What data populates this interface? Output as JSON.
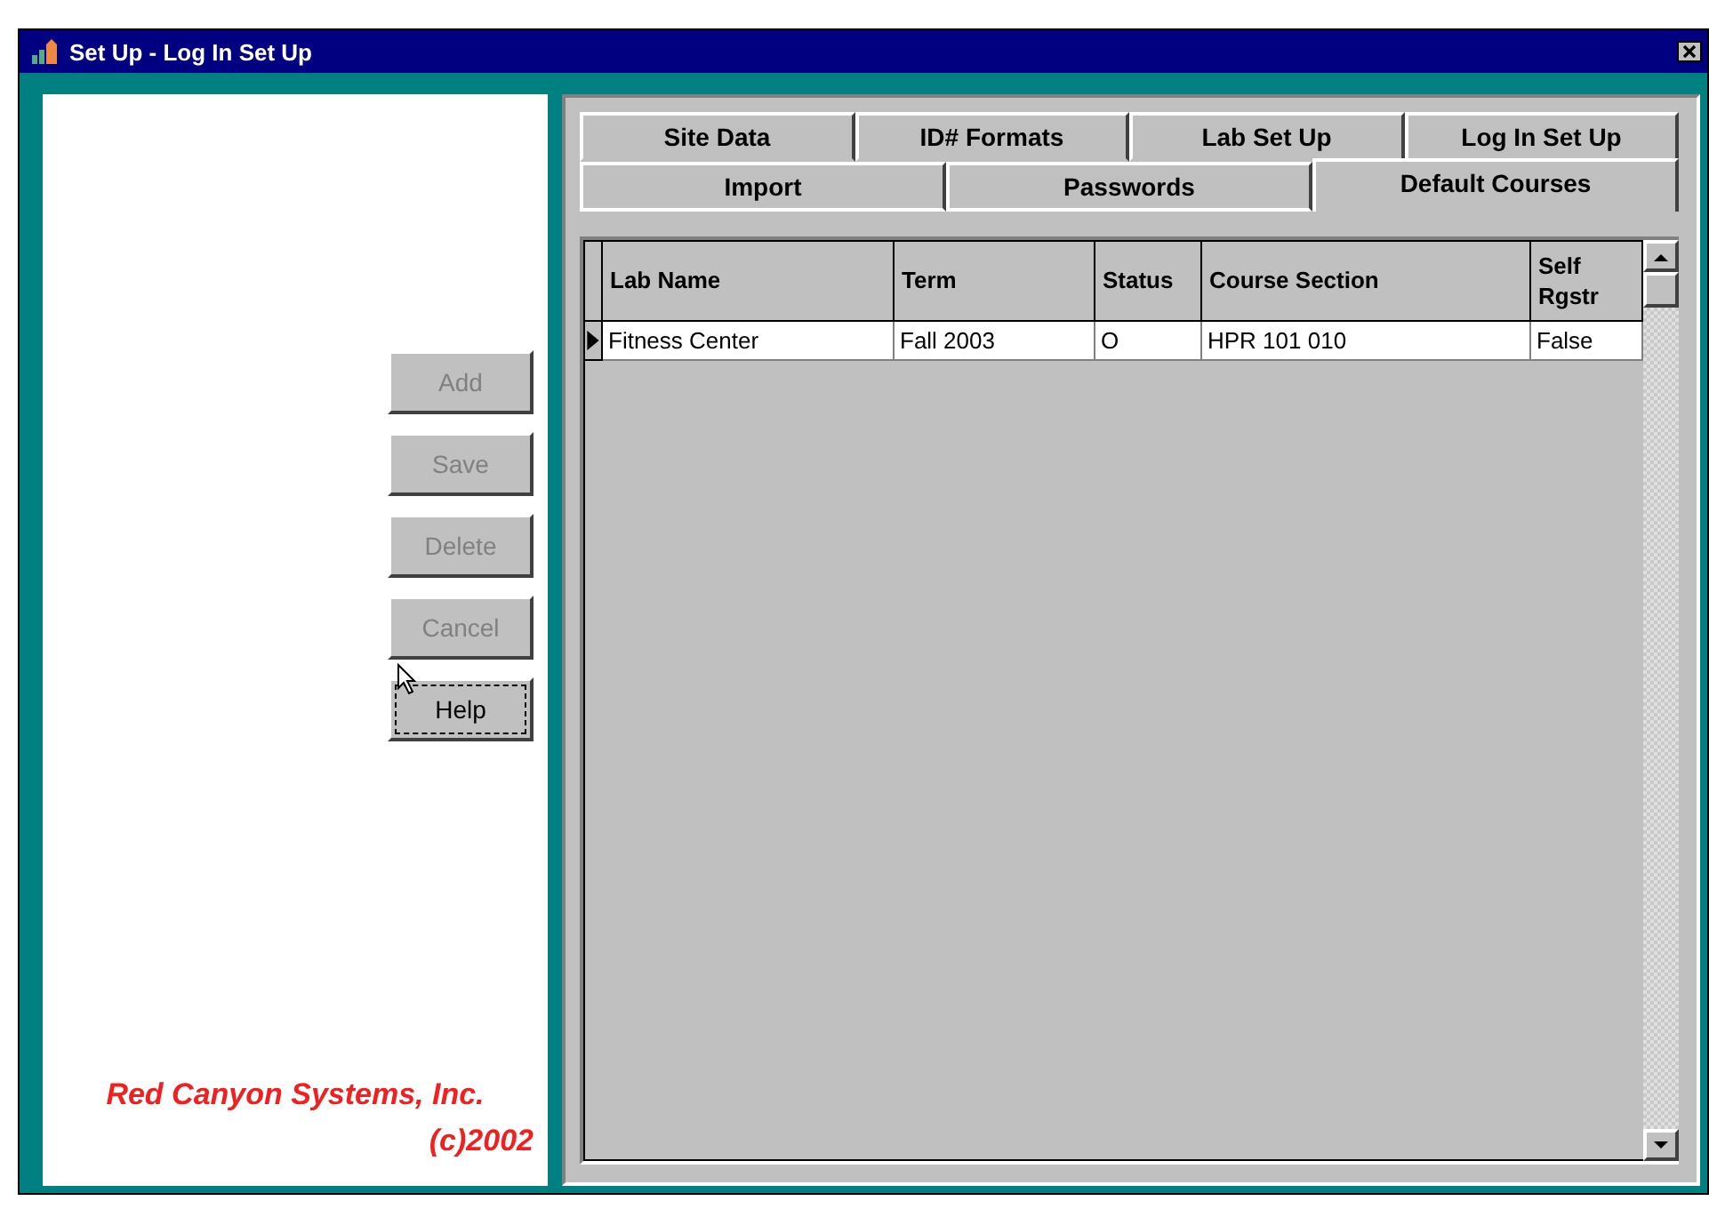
{
  "window": {
    "title": "Set Up - Log In Set Up"
  },
  "buttons": [
    {
      "label": "Add",
      "disabled": true,
      "focused": false
    },
    {
      "label": "Save",
      "disabled": true,
      "focused": false
    },
    {
      "label": "Delete",
      "disabled": true,
      "focused": false
    },
    {
      "label": "Cancel",
      "disabled": true,
      "focused": false
    },
    {
      "label": "Help",
      "disabled": false,
      "focused": true
    }
  ],
  "company": {
    "name": "Red Canyon Systems, Inc.",
    "copyright": "(c)2002"
  },
  "tab_rows": [
    [
      {
        "label": "Site Data",
        "selected": false
      },
      {
        "label": "ID# Formats",
        "selected": false
      },
      {
        "label": "Lab Set Up",
        "selected": false
      },
      {
        "label": "Log In Set Up",
        "selected": false
      }
    ],
    [
      {
        "label": "Import",
        "selected": false
      },
      {
        "label": "Passwords",
        "selected": false
      },
      {
        "label": "Default Courses",
        "selected": true
      }
    ]
  ],
  "table": {
    "columns": [
      "Lab Name",
      "Term",
      "Status",
      "Course Section",
      "Self Rgstr"
    ],
    "rows": [
      {
        "cells": [
          "Fitness Center",
          "Fall 2003",
          "O",
          "HPR 101 010",
          "False"
        ],
        "current": true
      }
    ]
  }
}
